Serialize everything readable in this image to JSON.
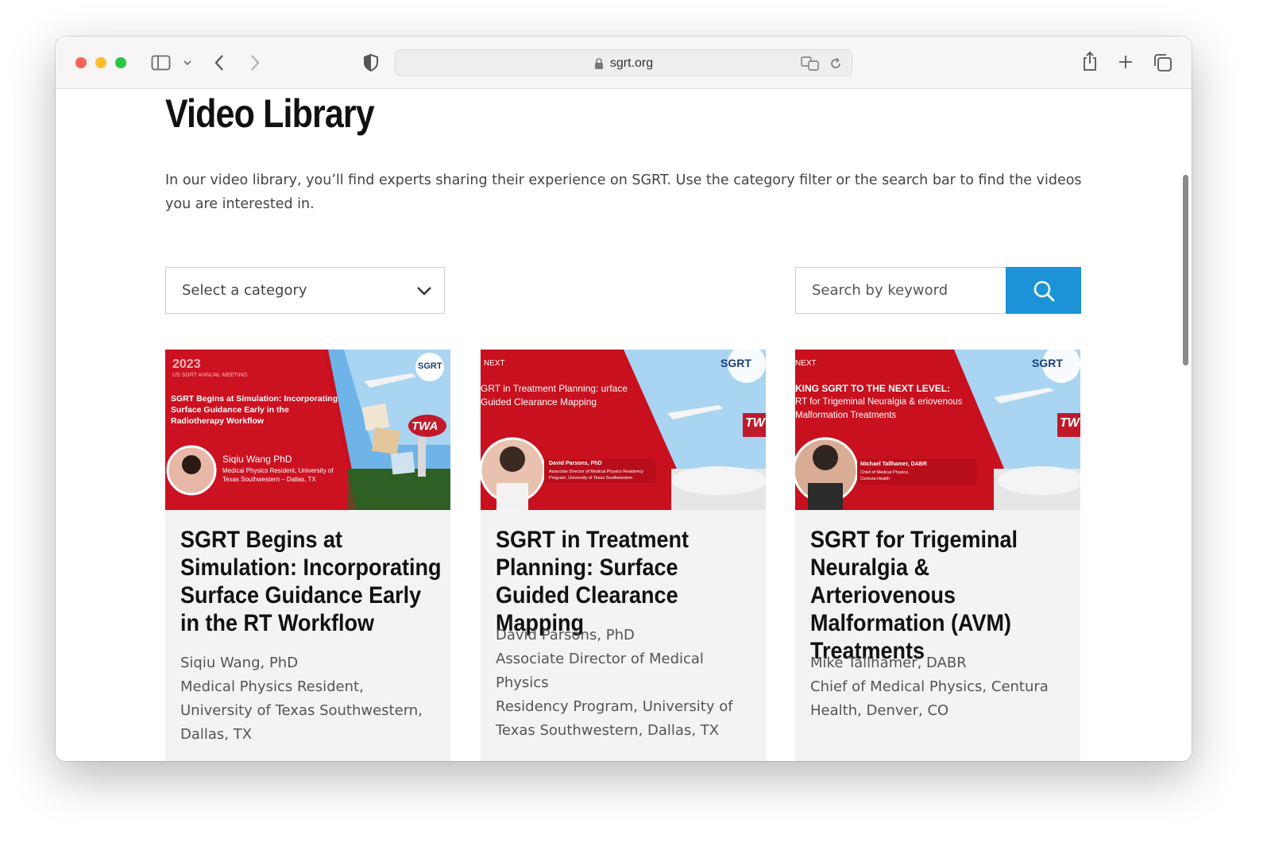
{
  "browser": {
    "url": "sgrt.org",
    "colors": {
      "close": "#fe5f57",
      "minimize": "#febc2e",
      "zoom": "#28c840"
    }
  },
  "page": {
    "title": "Video Library",
    "intro": "In our video library, you’ll find experts sharing their experience on SGRT. Use the category filter or the search bar to find the videos you are interested in.",
    "category_select": {
      "selected": "Select a category"
    },
    "search": {
      "placeholder": "Search by keyword"
    },
    "accent_color": "#1b93d6"
  },
  "cards": [
    {
      "title": "SGRT Begins at Simulation: Incorporating Surface Guidance Early in the RT Workflow",
      "meta": [
        "Siqiu Wang, PhD",
        "Medical Physics Resident,",
        "University of Texas Southwestern,",
        "Dallas, TX"
      ],
      "thumb": {
        "year": "2023",
        "event": "US SGRT ANNUAL MEETING",
        "headline": "SGRT Begins at Simulation: Incorporating Surface Guidance Early in the Radiotherapy Workflow",
        "speaker": "Siqiu Wang PhD",
        "speaker_role": "Medical Physics Resident, University of Texas Southwestern – Dallas, TX",
        "logo": "SGRT",
        "sign": "TWA"
      }
    },
    {
      "title": "SGRT in Treatment Planning: Surface Guided Clearance Mapping",
      "meta": [
        "David Parsons, PhD",
        "Associate Director of Medical Physics",
        "Residency Program, University of",
        "Texas Southwestern, Dallas, TX"
      ],
      "thumb": {
        "tag": "NEXT",
        "headline": "GRT in Treatment Planning: urface Guided Clearance Mapping",
        "speaker": "David Parsons, PhD",
        "speaker_role": "Associate Director of Medical Physics Residency Program, University of Texas Southwestern",
        "logo": "SGRT",
        "sign": "TW"
      }
    },
    {
      "title": "SGRT for Trigeminal Neuralgia & Arteriovenous Malformation (AVM) Treatments",
      "meta": [
        "Mike Tallhamer, DABR",
        "Chief of Medical Physics, Centura",
        "Health, Denver, CO"
      ],
      "thumb": {
        "tag": "NEXT",
        "headline": "KING SGRT TO THE NEXT LEVEL:",
        "subline": "RT for Trigeminal Neuralgia & eriovenous Malformation Treatments",
        "speaker": "Michael Tallhamer, DABR",
        "speaker_role": "Chief of Medical Physics, Centura Health",
        "logo": "SGRT",
        "sign": "TW"
      }
    }
  ]
}
